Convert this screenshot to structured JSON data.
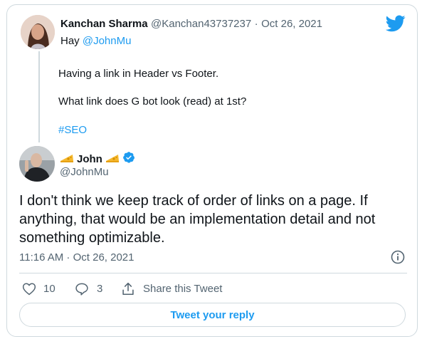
{
  "colors": {
    "accent": "#1d9bf0",
    "muted": "#536471",
    "text": "#0f1419",
    "border": "#cfd9de"
  },
  "parent_tweet": {
    "author_name": "Kanchan Sharma",
    "author_handle": "@Kanchan43737237",
    "separator": "·",
    "date": "Oct 26, 2021",
    "line1_prefix": "Hay ",
    "mention": "@JohnMu",
    "line2": "Having a link in Header vs Footer.",
    "line3": "What link does G bot look (read) at 1st?",
    "hashtag": "#SEO"
  },
  "reply_tweet": {
    "author_name": "John",
    "author_handle": "@JohnMu",
    "verified_icon": "verified-badge-icon",
    "name_decoration_icon": "cheese-icon",
    "text": "I don't think we keep track of order of links on a page. If anything, that would be an implementation detail and not something optimizable.",
    "time": "11:16 AM · Oct 26, 2021"
  },
  "actions": {
    "likes": "10",
    "replies": "3",
    "share_label": "Share this Tweet"
  },
  "reply_button_label": "Tweet your reply",
  "icons": {
    "brand": "twitter-bird-icon",
    "info": "info-icon",
    "like": "heart-icon",
    "reply": "reply-bubble-icon",
    "share": "share-icon"
  }
}
